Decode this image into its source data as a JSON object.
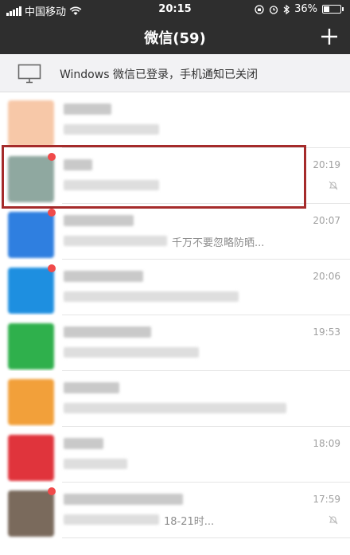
{
  "status": {
    "carrier": "中国移动",
    "time": "20:15",
    "battery": "36%",
    "battery_level": 0.36
  },
  "nav": {
    "title": "微信(59)",
    "add_icon": "plus-icon"
  },
  "banner": {
    "icon": "monitor-icon",
    "text": "Windows 微信已登录，手机通知已关闭"
  },
  "chats": [
    {
      "time": "",
      "preview": "",
      "avatar_color": "#f7c8a8",
      "unread": false,
      "muted": false
    },
    {
      "time": "20:19",
      "preview": "",
      "avatar_color": "#8fa8a0",
      "unread": true,
      "muted": true
    },
    {
      "time": "20:07",
      "preview": "千万不要忽略防晒...",
      "avatar_color": "#2f7fe0",
      "unread": true,
      "muted": false
    },
    {
      "time": "20:06",
      "preview": "",
      "avatar_color": "#1e8fe0",
      "unread": true,
      "muted": false
    },
    {
      "time": "19:53",
      "preview": "",
      "avatar_color": "#2fb04c",
      "unread": false,
      "muted": false
    },
    {
      "time": "",
      "preview": "",
      "avatar_color": "#f2a03a",
      "unread": false,
      "muted": false
    },
    {
      "time": "18:09",
      "preview": "",
      "avatar_color": "#e0343c",
      "unread": false,
      "muted": false
    },
    {
      "time": "17:59",
      "preview": "18-21时...",
      "avatar_color": "#7a6a5c",
      "unread": true,
      "muted": true
    }
  ],
  "colors": {
    "header": "#2e2e2e",
    "banner_bg": "#f2f2f4",
    "highlight": "#a52b2b",
    "unread": "#f04a4a"
  }
}
